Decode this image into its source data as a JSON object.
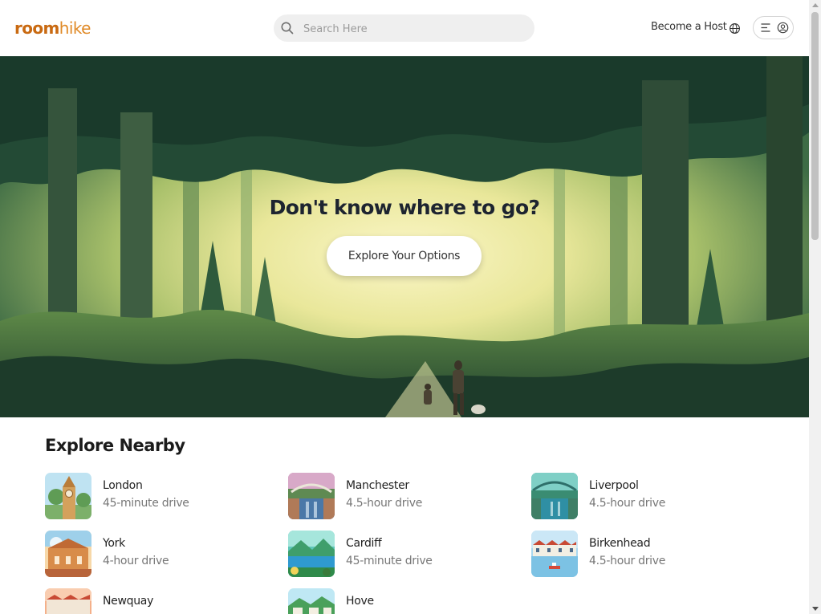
{
  "brand": {
    "part1": "room",
    "part2": "hike",
    "colors": {
      "primary": "#c96a12",
      "secondary": "#e08a27"
    }
  },
  "search": {
    "placeholder": "Search Here",
    "value": "",
    "icon": "search-icon"
  },
  "header": {
    "become_host": "Become a Host",
    "globe_icon": "globe-icon",
    "menu_icon": "menu-icon",
    "user_icon": "user-circle-icon"
  },
  "hero": {
    "title": "Don't know where to go?",
    "button": "Explore Your Options"
  },
  "explore": {
    "title": "Explore Nearby",
    "places": [
      {
        "name": "London",
        "drive": "45-minute drive"
      },
      {
        "name": "Manchester",
        "drive": "4.5-hour drive"
      },
      {
        "name": "Liverpool",
        "drive": "4.5-hour drive"
      },
      {
        "name": "York",
        "drive": "4-hour drive"
      },
      {
        "name": "Cardiff",
        "drive": "45-minute drive"
      },
      {
        "name": "Birkenhead",
        "drive": "4.5-hour drive"
      },
      {
        "name": "Newquay",
        "drive": ""
      },
      {
        "name": "Hove",
        "drive": ""
      }
    ]
  }
}
